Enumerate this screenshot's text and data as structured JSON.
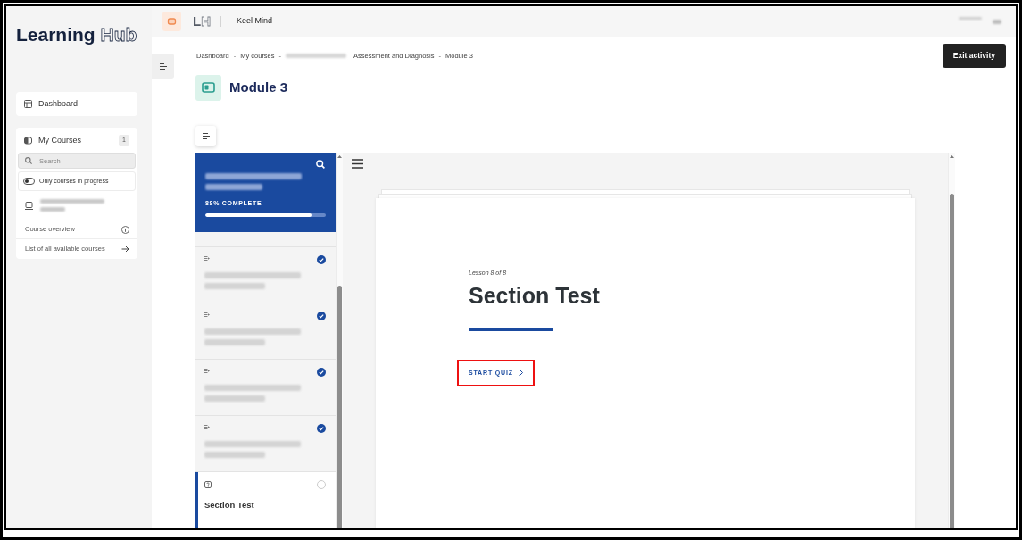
{
  "sidebar": {
    "logo": {
      "bold": "Learning",
      "outlined": "Hub"
    },
    "nav": [
      {
        "label": "Dashboard"
      }
    ],
    "my_courses": {
      "title": "My Courses",
      "count": "1",
      "search": {
        "placeholder": "Search"
      },
      "filter": {
        "label": "Only courses in progress",
        "on": false
      },
      "courses": [
        {
          "kind": "redacted"
        }
      ],
      "links": [
        {
          "kind": "info",
          "label": "Course overview"
        },
        {
          "kind": "arrow",
          "label": "List of all available courses"
        }
      ]
    }
  },
  "topbar": {
    "logo": {
      "bold": "L",
      "outlined": "H"
    },
    "workspace": "Keel Mind"
  },
  "breadcrumb": [
    {
      "kind": "link",
      "label": "Dashboard"
    },
    {
      "kind": "separator",
      "label": "-"
    },
    {
      "kind": "link",
      "label": "My courses"
    },
    {
      "kind": "separator",
      "label": "-"
    },
    {
      "kind": "redacted"
    },
    {
      "kind": "link",
      "label": "Assessment and Diagnosis"
    },
    {
      "kind": "separator",
      "label": "-"
    },
    {
      "kind": "link",
      "label": "Module 3"
    }
  ],
  "exit_button": "Exit activity",
  "page_title": "Module 3",
  "lesson_panel": {
    "progress": {
      "label": "88% COMPLETE",
      "level": 0.88
    },
    "lessons": [
      {
        "kind": "lesson",
        "completed": true,
        "selected": false
      },
      {
        "kind": "lesson",
        "completed": true,
        "selected": false
      },
      {
        "kind": "lesson",
        "completed": true,
        "selected": false
      },
      {
        "kind": "lesson",
        "completed": true,
        "selected": false
      },
      {
        "kind": "quiz",
        "title": "Section Test",
        "completed": false,
        "selected": true
      }
    ]
  },
  "lesson": {
    "counter": "Lesson 8 of 8",
    "title": "Section Test",
    "start_button": {
      "label": "START QUIZ",
      "highlighted": true
    }
  }
}
